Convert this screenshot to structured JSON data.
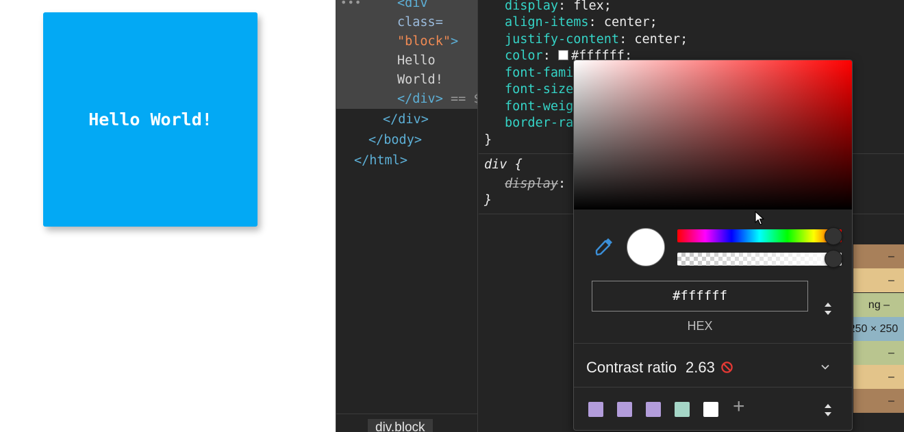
{
  "preview": {
    "block_text": "Hello World!"
  },
  "elements": {
    "dots": "•••",
    "lines": [
      {
        "text": "<div"
      },
      {
        "text": "class="
      },
      {
        "text": "\"block\""
      },
      {
        "text": "Hello"
      },
      {
        "text": "World!"
      },
      {
        "text": "</div>"
      },
      {
        "text": "</div>"
      },
      {
        "text": "</body>"
      },
      {
        "text": "</html>"
      }
    ],
    "eq_marker": "== $",
    "block_close": ">",
    "breadcrumb": "div.block"
  },
  "styles": {
    "rule1": [
      {
        "prop": "display",
        "value": "flex;"
      },
      {
        "prop": "align-items",
        "value": "center;"
      },
      {
        "prop": "justify-content",
        "value": "center;"
      },
      {
        "prop": "color",
        "value": "#ffffff;"
      },
      {
        "prop": "font-fami",
        "value": ""
      },
      {
        "prop": "font-size",
        "value": ""
      },
      {
        "prop": "font-weig",
        "value": ""
      },
      {
        "prop": "border-ra",
        "value": ""
      }
    ],
    "rule1_close": "}",
    "rule2_selector": "div",
    "rule2_open": "{",
    "rule2_prop": "display",
    "rule2_close": "}",
    "colon": ":"
  },
  "box_model": {
    "rows": [
      "–",
      "–",
      "ng –",
      "250 × 250",
      "–",
      "–",
      "–"
    ],
    "colors": [
      "#a8805a",
      "#e3c48a",
      "#b9c58f",
      "#8fb4c4",
      "#b9c58f",
      "#e3c48a",
      "#a8805a"
    ]
  },
  "color_picker": {
    "hex_value": "#ffffff",
    "format_label": "HEX",
    "contrast_label": "Contrast ratio",
    "contrast_value": "2.63",
    "add_label": "+",
    "palette": [
      "#b39ddb",
      "#b39ddb",
      "#b39ddb",
      "#a5d6c7",
      "#ffffff"
    ],
    "accent": "#3b8fd8",
    "fail_color": "#e53935"
  }
}
